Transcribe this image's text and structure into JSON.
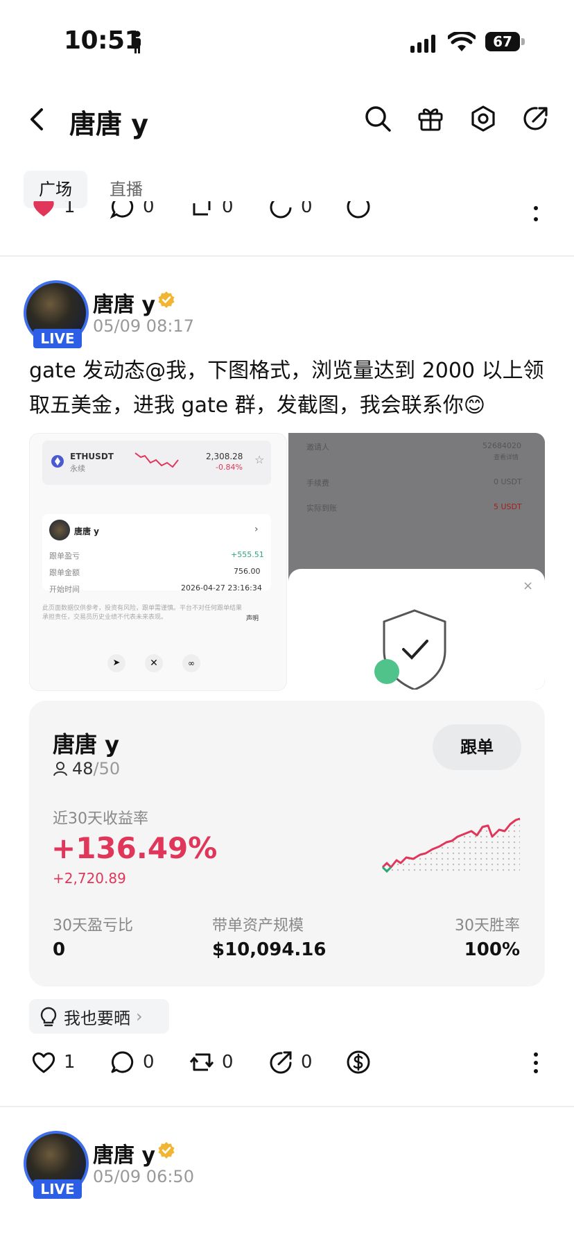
{
  "status_bar": {
    "time": "10:51",
    "battery": "67"
  },
  "header": {
    "title": "唐唐 y"
  },
  "tabs": [
    {
      "label": "广场"
    },
    {
      "label": "直播"
    }
  ],
  "top_actions": {
    "like": "1",
    "comment": "0",
    "repost": "0",
    "share": "0"
  },
  "post": {
    "author": "唐唐 y",
    "live": "LIVE",
    "time": "05/09 08:17",
    "text": "gate 发动态@我，下图格式，浏览量达到 2000 以上领取五美金，进我 gate 群，发截图，我会联系你😊",
    "shot_left": {
      "pair": "ETHUSDT",
      "pair_sub": "永续",
      "price": "2,308.28",
      "change": "-0.84%",
      "trader": "唐唐 y",
      "rows": [
        {
          "k": "跟单盈亏",
          "v": "+555.51"
        },
        {
          "k": "跟单金额",
          "v": "756.00"
        },
        {
          "k": "开始时间",
          "v": "2026-04-27 23:16:34"
        }
      ],
      "disclaimer": "此页面数据仅供参考，投资有风险，跟单需谨慎。平台不对任何跟单结果承担责任，交易员历史业绩不代表未来表现。",
      "disclaimer_link": "声明"
    },
    "shot_right": {
      "rows": [
        {
          "k": "邀请人",
          "v": "52684020",
          "sub": "查看详情"
        },
        {
          "k": "手续费",
          "v": "0 USDT"
        },
        {
          "k": "实际到账",
          "v": "5 USDT"
        }
      ]
    },
    "trade_card": {
      "name": "唐唐 y",
      "followers": "48",
      "followers_max": "/50",
      "follow_btn": "跟单",
      "roi_label": "近30天收益率",
      "roi": "+136.49%",
      "pnl": "+2,720.89",
      "stats": [
        {
          "label": "30天盈亏比",
          "value": "0"
        },
        {
          "label": "带单资产规模",
          "value": "$10,094.16"
        },
        {
          "label": "30天胜率",
          "value": "100%"
        }
      ]
    },
    "share_pill": "我也要晒",
    "actions": {
      "like": "1",
      "comment": "0",
      "repost": "0",
      "share": "0"
    }
  },
  "next_post": {
    "author": "唐唐 y",
    "live": "LIVE",
    "time": "05/09 06:50"
  },
  "colors": {
    "accent_red": "#e0365a",
    "live_blue": "#2c5ee6",
    "verified_gold": "#f2b531"
  }
}
